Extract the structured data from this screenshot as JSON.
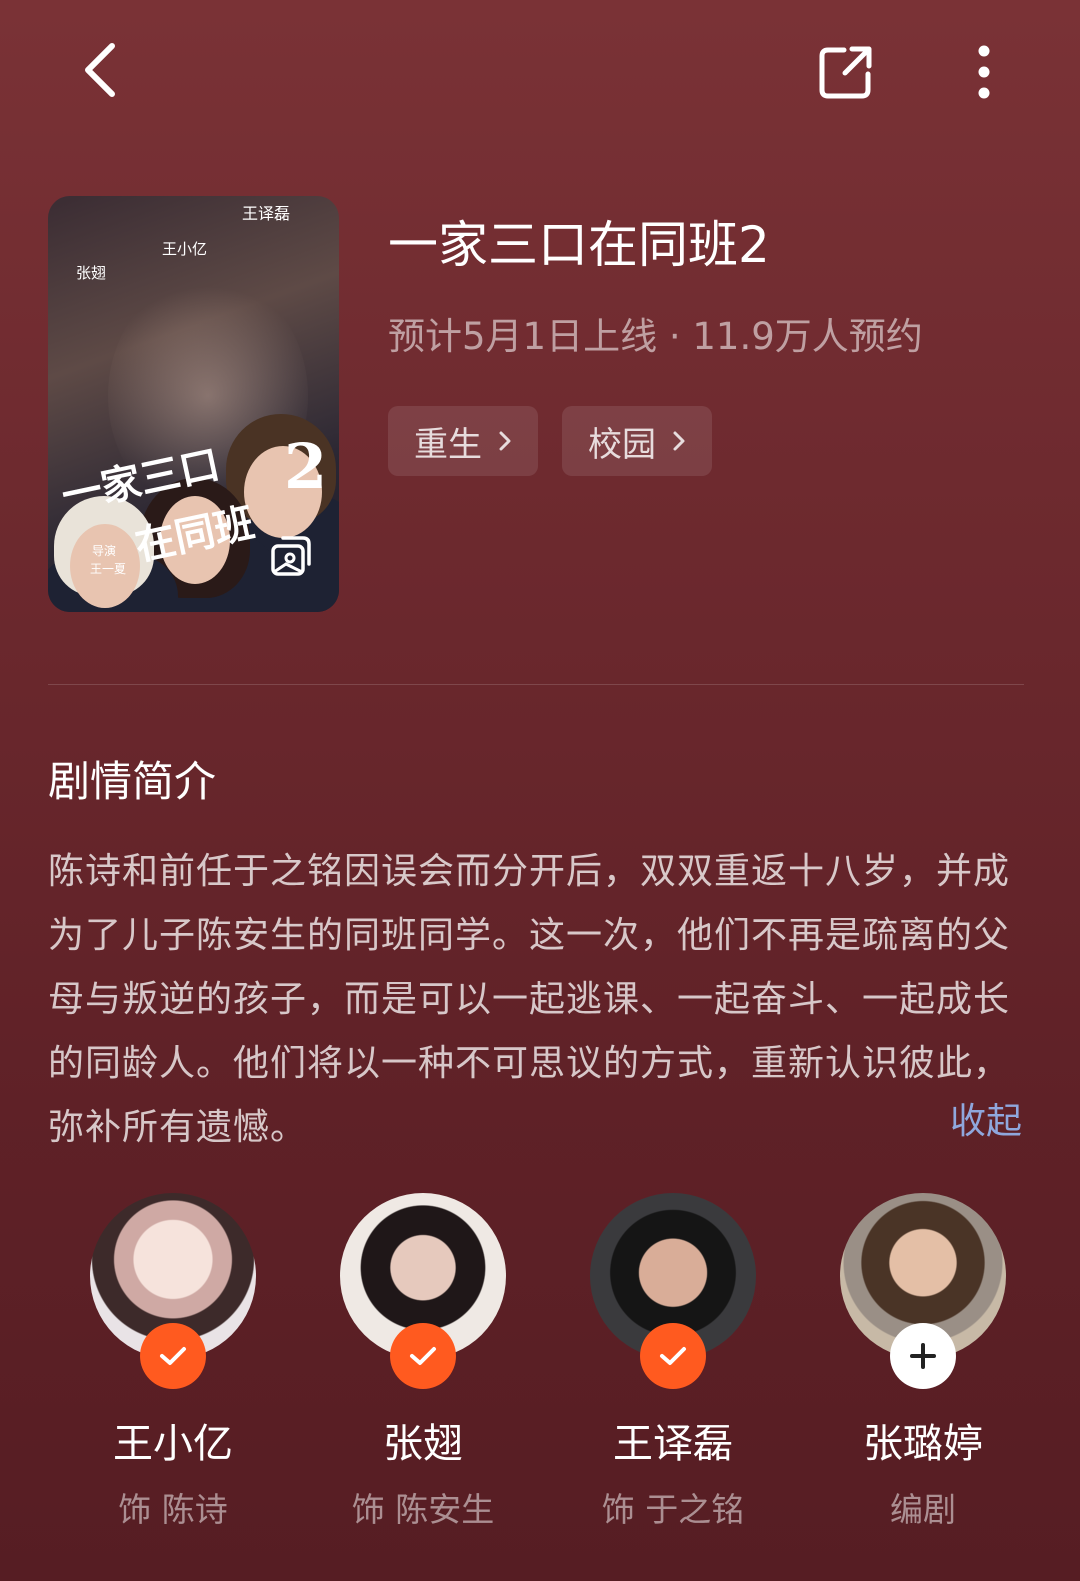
{
  "icons": {
    "back": "back-arrow-icon",
    "share": "share-icon",
    "more": "more-vertical-icon",
    "gallery": "gallery-icon"
  },
  "poster": {
    "cast_top": "王译磊",
    "cast_mid": "王小亿",
    "cast_left": "张翅",
    "title_line1": "一家三口",
    "title_line2": "在同班",
    "number": "2",
    "director_label": "导演",
    "director": "王一夏"
  },
  "show": {
    "title": "一家三口在同班2",
    "meta": "预计5月1日上线 · 11.9万人预约",
    "tags": [
      "重生",
      "校园"
    ]
  },
  "synopsis": {
    "heading": "剧情简介",
    "text": "陈诗和前任于之铭因误会而分开后，双双重返十八岁，并成为了儿子陈安生的同班同学。这一次，他们不再是疏离的父母与叛逆的孩子，而是可以一起逃课、一起奋斗、一起成长的同龄人。他们将以一种不可思议的方式，重新认识彼此，弥补所有遗憾。",
    "collapse_label": "收起"
  },
  "cast": [
    {
      "name": "王小亿",
      "role": "饰 陈诗",
      "followed": true
    },
    {
      "name": "张翅",
      "role": "饰 陈安生",
      "followed": true
    },
    {
      "name": "王译磊",
      "role": "饰 于之铭",
      "followed": true
    },
    {
      "name": "张璐婷",
      "role": "编剧",
      "followed": false
    }
  ],
  "colors": {
    "accent": "#ff5a1f",
    "link": "#8fa7dd",
    "background": "#6a272c"
  }
}
